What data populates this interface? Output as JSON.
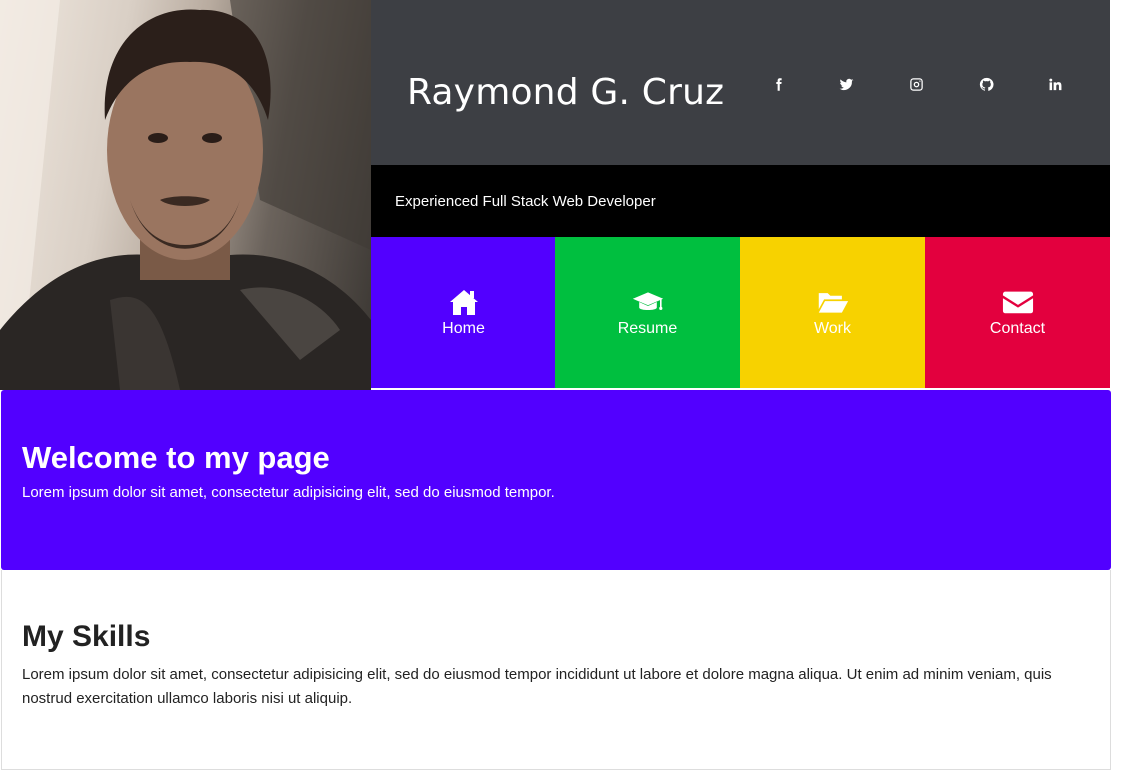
{
  "profile": {
    "name": "Raymond G. Cruz",
    "tagline": "Experienced Full Stack Web Developer"
  },
  "social": [
    {
      "icon": "facebook-icon"
    },
    {
      "icon": "twitter-icon"
    },
    {
      "icon": "instagram-icon"
    },
    {
      "icon": "github-icon"
    },
    {
      "icon": "linkedin-icon"
    }
  ],
  "nav": [
    {
      "label": "Home",
      "icon": "home-icon",
      "color": "#5200ff"
    },
    {
      "label": "Resume",
      "icon": "graduation-cap-icon",
      "color": "#00bf3f"
    },
    {
      "label": "Work",
      "icon": "folder-open-icon",
      "color": "#f7d200"
    },
    {
      "label": "Contact",
      "icon": "envelope-icon",
      "color": "#e3003e"
    }
  ],
  "welcome": {
    "heading": "Welcome to my page",
    "text": "Lorem ipsum dolor sit amet, consectetur adipisicing elit, sed do eiusmod tempor."
  },
  "skills": {
    "heading": "My Skills",
    "text": "Lorem ipsum dolor sit amet, consectetur adipisicing elit, sed do eiusmod tempor incididunt ut labore et dolore magna aliqua. Ut enim ad minim veniam, quis nostrud exercitation ullamco laboris nisi ut aliquip."
  },
  "colors": {
    "header_bg": "#3d3f44",
    "tagline_bg": "#000000",
    "welcome_bg": "#5200ff"
  }
}
